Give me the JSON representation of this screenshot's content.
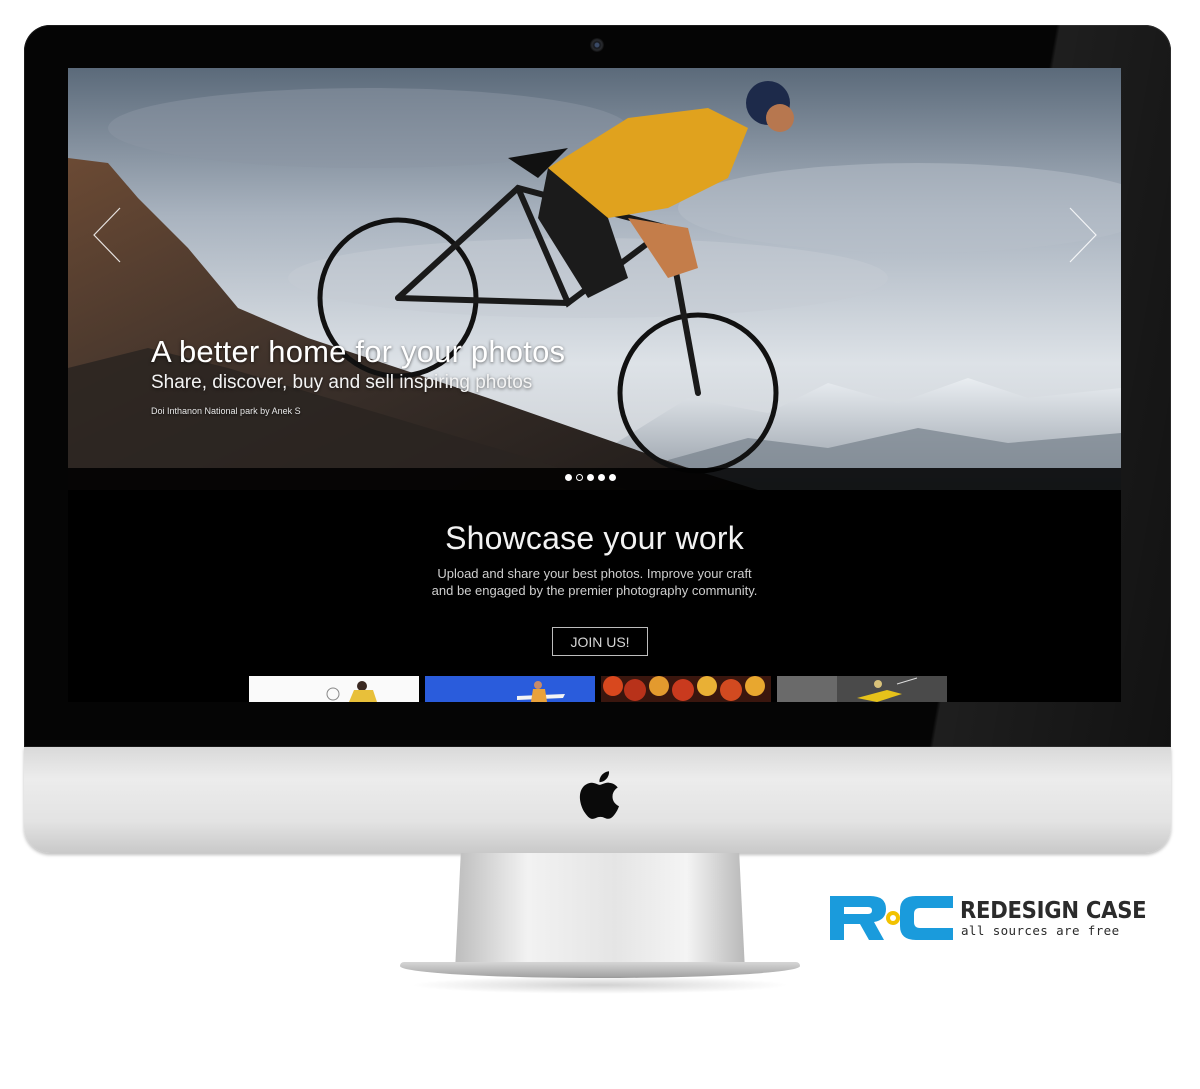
{
  "hero": {
    "title": "A better home for your photos",
    "subtitle": "Share, discover, buy and sell inspiring photos",
    "credit": "Doi Inthanon National park by Anek S",
    "slides": 5,
    "active_slide": 1
  },
  "showcase": {
    "title": "Showcase your work",
    "desc_line1": "Upload and share your best photos. Improve your craft",
    "desc_line2": "and be engaged by the premier photography community.",
    "cta_label": "JOIN US!"
  },
  "brand": {
    "name": "REDESIGN CASE",
    "tagline": "all sources are free",
    "mark_letters": "RC",
    "accent": "#1a9bdc",
    "dot_color": "#f2c200"
  },
  "colors": {
    "bezel": "#050505",
    "screen_bg": "#000000",
    "chin": "#e3e3e3"
  },
  "icons": {
    "prev": "chevron-left-icon",
    "next": "chevron-right-icon",
    "apple": "apple-logo-icon"
  }
}
